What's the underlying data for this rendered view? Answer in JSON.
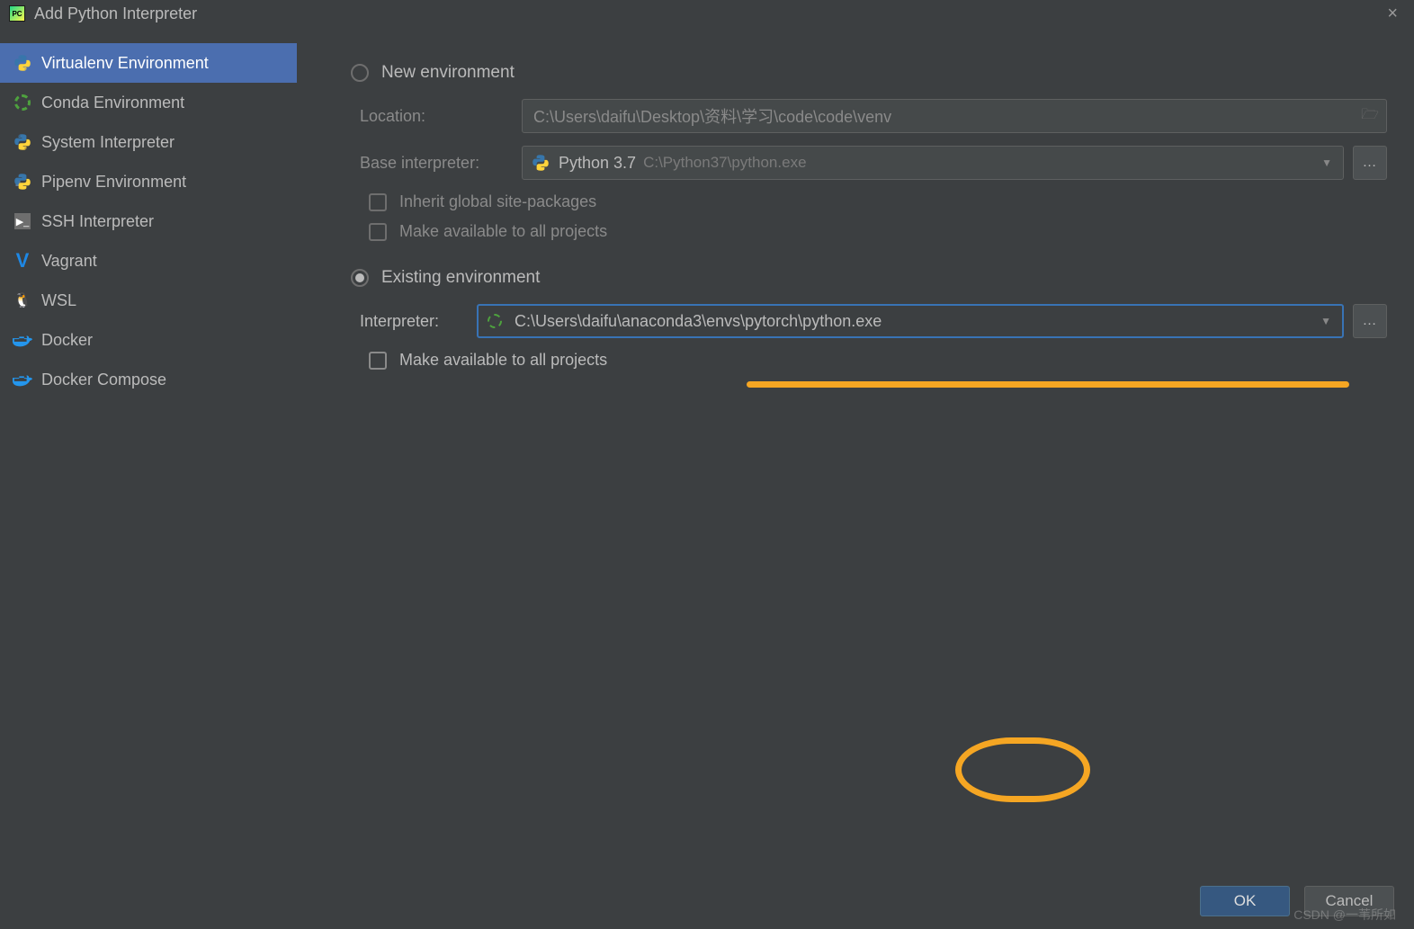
{
  "window": {
    "title": "Add Python Interpreter"
  },
  "sidebar": {
    "items": [
      {
        "label": "Virtualenv Environment"
      },
      {
        "label": "Conda Environment"
      },
      {
        "label": "System Interpreter"
      },
      {
        "label": "Pipenv Environment"
      },
      {
        "label": "SSH Interpreter"
      },
      {
        "label": "Vagrant"
      },
      {
        "label": "WSL"
      },
      {
        "label": "Docker"
      },
      {
        "label": "Docker Compose"
      }
    ]
  },
  "form": {
    "new_env_label": "New environment",
    "existing_env_label": "Existing environment",
    "location_label": "Location:",
    "location_value": "C:\\Users\\daifu\\Desktop\\资料\\学习\\code\\code\\venv",
    "base_interp_label": "Base interpreter:",
    "base_interp_value": "Python 3.7",
    "base_interp_sub": "C:\\Python37\\python.exe",
    "inherit_label": "Inherit global site-packages",
    "make_available_label": "Make available to all projects",
    "interpreter_label": "Interpreter:",
    "interpreter_value": "C:\\Users\\daifu\\anaconda3\\envs\\pytorch\\python.exe"
  },
  "buttons": {
    "ok": "OK",
    "cancel": "Cancel"
  },
  "watermark": "CSDN @一苇所如"
}
